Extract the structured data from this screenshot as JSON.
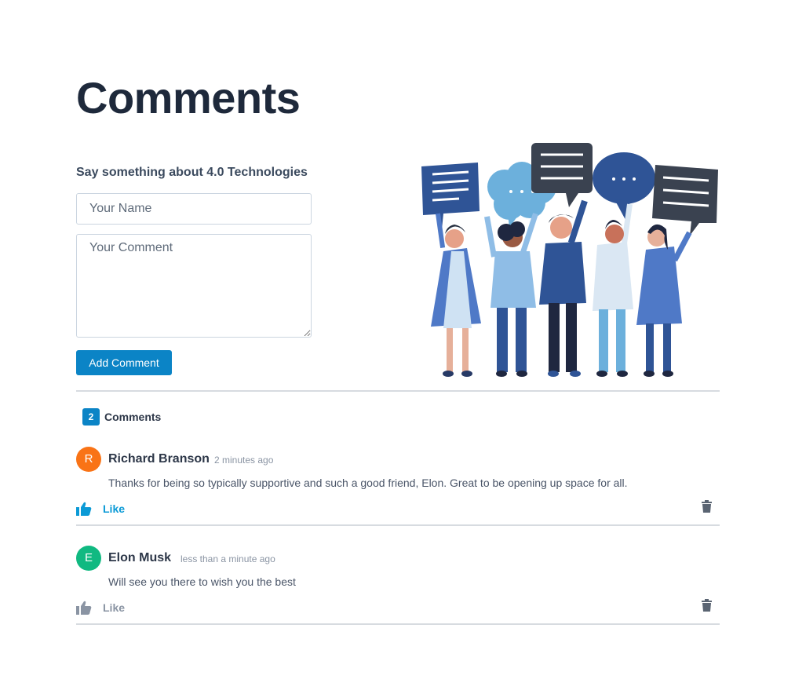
{
  "page": {
    "title": "Comments"
  },
  "form": {
    "prompt": "Say something about 4.0 Technologies",
    "name_placeholder": "Your Name",
    "comment_placeholder": "Your Comment",
    "submit_label": "Add Comment"
  },
  "summary": {
    "count": "2",
    "label": "Comments"
  },
  "comments": [
    {
      "initial": "R",
      "author": "Richard Branson",
      "time": "2 minutes ago",
      "text": "Thanks for being so typically supportive and such a good friend, Elon. Great to be opening up space for all.",
      "like_label": "Like",
      "liked": true,
      "avatar_color": "#f97316"
    },
    {
      "initial": "E",
      "author": "Elon Musk",
      "time": "less than a minute ago",
      "text": "Will see you there to wish you the best",
      "like_label": "Like",
      "liked": false,
      "avatar_color": "#10b981"
    }
  ],
  "colors": {
    "accent": "#0b84c6",
    "like_active": "#0b9ad6",
    "like_inactive": "#8a94a3"
  }
}
